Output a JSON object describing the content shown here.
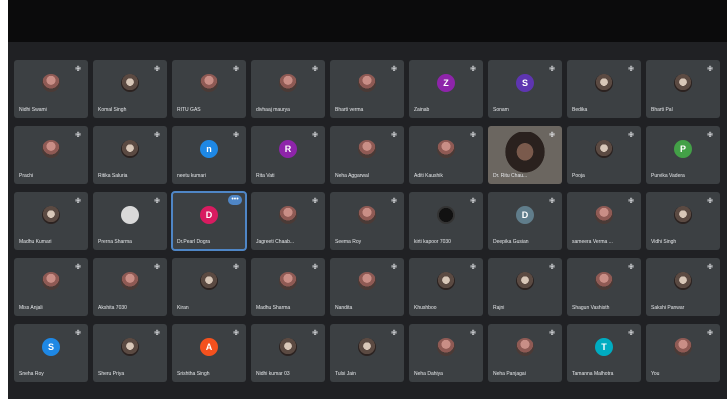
{
  "participants": [
    {
      "name": "Nidhi Swami",
      "avatar": "photo"
    },
    {
      "name": "Komal Singh",
      "avatar": "pic"
    },
    {
      "name": "RITU GAS",
      "avatar": "photo"
    },
    {
      "name": "divhaaj maurya",
      "avatar": "photo"
    },
    {
      "name": "Bharti verma",
      "avatar": "photo"
    },
    {
      "name": "Zainab",
      "avatar": "letter",
      "initial": "Z",
      "color": "#8e24aa"
    },
    {
      "name": "Sonam",
      "avatar": "letter",
      "initial": "S",
      "color": "#5e35b1"
    },
    {
      "name": "Bedika",
      "avatar": "pic"
    },
    {
      "name": "Bharti Pal",
      "avatar": "pic"
    },
    {
      "name": "Prachi",
      "avatar": "photo"
    },
    {
      "name": "Ritika Saluria",
      "avatar": "pic"
    },
    {
      "name": "neetu kumari",
      "avatar": "letter",
      "initial": "n",
      "color": "#1e88e5"
    },
    {
      "name": "Rita Vati",
      "avatar": "letter",
      "initial": "R",
      "color": "#8e24aa"
    },
    {
      "name": "Neha Aggarwal",
      "avatar": "photo"
    },
    {
      "name": "Aditi Kaushik",
      "avatar": "photo"
    },
    {
      "name": "Dr. Ritu Chau...",
      "avatar": "video"
    },
    {
      "name": "Pooja",
      "avatar": "pic"
    },
    {
      "name": "Purvika Vadera",
      "avatar": "letter",
      "initial": "P",
      "color": "#43a047"
    },
    {
      "name": "Madhu Kumari",
      "avatar": "pic"
    },
    {
      "name": "Prerna Sharma",
      "avatar": "grey"
    },
    {
      "name": "Dr.Pearl Dogra",
      "avatar": "letter",
      "initial": "D",
      "color": "#d81b60",
      "active": true
    },
    {
      "name": "Jagreeti Chaab...",
      "avatar": "photo"
    },
    {
      "name": "Seema Roy",
      "avatar": "photo"
    },
    {
      "name": "kirti kapoor 7030",
      "avatar": "dark"
    },
    {
      "name": "Deepika Gusian",
      "avatar": "letter",
      "initial": "D",
      "color": "#607d8b"
    },
    {
      "name": "sameera Verma ...",
      "avatar": "photo"
    },
    {
      "name": "Vidhi Singh",
      "avatar": "pic"
    },
    {
      "name": "Miss Anjali",
      "avatar": "photo"
    },
    {
      "name": "Akshita 7030",
      "avatar": "photo"
    },
    {
      "name": "Kiran",
      "avatar": "pic"
    },
    {
      "name": "Madhu Sharma",
      "avatar": "photo"
    },
    {
      "name": "Nandita",
      "avatar": "photo"
    },
    {
      "name": "Khushboo",
      "avatar": "pic"
    },
    {
      "name": "Rajni",
      "avatar": "pic"
    },
    {
      "name": "Shagun Vashisth",
      "avatar": "photo"
    },
    {
      "name": "Sakshi Panwar",
      "avatar": "pic"
    },
    {
      "name": "Sneha Roy",
      "avatar": "letter",
      "initial": "S",
      "color": "#1e88e5"
    },
    {
      "name": "Sheru Priya",
      "avatar": "pic"
    },
    {
      "name": "Srishtha Singh",
      "avatar": "letter",
      "initial": "A",
      "color": "#f4511e"
    },
    {
      "name": "Nidhi kumar 03",
      "avatar": "pic"
    },
    {
      "name": "Tulsi Jain",
      "avatar": "pic"
    },
    {
      "name": "Neha Dahiya",
      "avatar": "photo"
    },
    {
      "name": "Neha Panjagai",
      "avatar": "photo"
    },
    {
      "name": "Tamanna Malhotra",
      "avatar": "letter",
      "initial": "T",
      "color": "#00acc1"
    },
    {
      "name": "You",
      "avatar": "photo"
    }
  ],
  "icons": {
    "mic": "mic-icon",
    "more": "more-options-icon"
  }
}
